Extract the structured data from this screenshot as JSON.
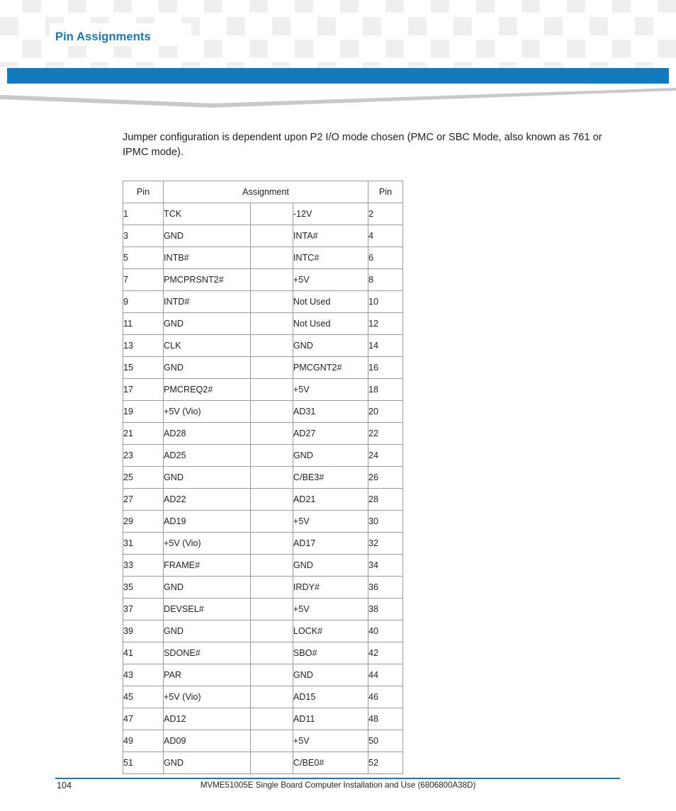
{
  "header": {
    "title": "Pin Assignments",
    "accent_color": "#1479bd"
  },
  "intro": {
    "paragraph": "Jumper configuration is dependent upon P2 I/O mode chosen (PMC or SBC Mode, also known as 761 or IPMC mode)."
  },
  "table": {
    "headers": {
      "pin_left": "Pin",
      "assignment": "Assignment",
      "pin_right": "Pin"
    },
    "rows": [
      {
        "pin_l": "1",
        "assign_l": "TCK",
        "assign_r": "-12V",
        "pin_r": "2"
      },
      {
        "pin_l": "3",
        "assign_l": "GND",
        "assign_r": "INTA#",
        "pin_r": "4"
      },
      {
        "pin_l": "5",
        "assign_l": "INTB#",
        "assign_r": "INTC#",
        "pin_r": "6"
      },
      {
        "pin_l": "7",
        "assign_l": "PMCPRSNT2#",
        "assign_r": "+5V",
        "pin_r": "8"
      },
      {
        "pin_l": "9",
        "assign_l": "INTD#",
        "assign_r": "Not Used",
        "pin_r": "10"
      },
      {
        "pin_l": "11",
        "assign_l": "GND",
        "assign_r": "Not Used",
        "pin_r": "12"
      },
      {
        "pin_l": "13",
        "assign_l": "CLK",
        "assign_r": "GND",
        "pin_r": "14"
      },
      {
        "pin_l": "15",
        "assign_l": "GND",
        "assign_r": "PMCGNT2#",
        "pin_r": "16"
      },
      {
        "pin_l": "17",
        "assign_l": "PMCREQ2#",
        "assign_r": "+5V",
        "pin_r": "18"
      },
      {
        "pin_l": "19",
        "assign_l": "+5V (Vio)",
        "assign_r": "AD31",
        "pin_r": "20"
      },
      {
        "pin_l": "21",
        "assign_l": "AD28",
        "assign_r": "AD27",
        "pin_r": "22"
      },
      {
        "pin_l": "23",
        "assign_l": "AD25",
        "assign_r": "GND",
        "pin_r": "24"
      },
      {
        "pin_l": "25",
        "assign_l": "GND",
        "assign_r": "C/BE3#",
        "pin_r": "26"
      },
      {
        "pin_l": "27",
        "assign_l": "AD22",
        "assign_r": "AD21",
        "pin_r": "28"
      },
      {
        "pin_l": "29",
        "assign_l": "AD19",
        "assign_r": "+5V",
        "pin_r": "30"
      },
      {
        "pin_l": "31",
        "assign_l": "+5V (Vio)",
        "assign_r": "AD17",
        "pin_r": "32"
      },
      {
        "pin_l": "33",
        "assign_l": "FRAME#",
        "assign_r": "GND",
        "pin_r": "34"
      },
      {
        "pin_l": "35",
        "assign_l": "GND",
        "assign_r": "IRDY#",
        "pin_r": "36"
      },
      {
        "pin_l": "37",
        "assign_l": "DEVSEL#",
        "assign_r": "+5V",
        "pin_r": "38"
      },
      {
        "pin_l": "39",
        "assign_l": "GND",
        "assign_r": "LOCK#",
        "pin_r": "40"
      },
      {
        "pin_l": "41",
        "assign_l": "SDONE#",
        "assign_r": "SBO#",
        "pin_r": "42"
      },
      {
        "pin_l": "43",
        "assign_l": "PAR",
        "assign_r": "GND",
        "pin_r": "44"
      },
      {
        "pin_l": "45",
        "assign_l": "+5V (Vio)",
        "assign_r": "AD15",
        "pin_r": "46"
      },
      {
        "pin_l": "47",
        "assign_l": "AD12",
        "assign_r": "AD11",
        "pin_r": "48"
      },
      {
        "pin_l": "49",
        "assign_l": "AD09",
        "assign_r": "+5V",
        "pin_r": "50"
      },
      {
        "pin_l": "51",
        "assign_l": "GND",
        "assign_r": "C/BE0#",
        "pin_r": "52"
      }
    ]
  },
  "footer": {
    "page_number": "104",
    "document_line": "MVME51005E Single Board Computer Installation and Use (6806800A38D)"
  }
}
